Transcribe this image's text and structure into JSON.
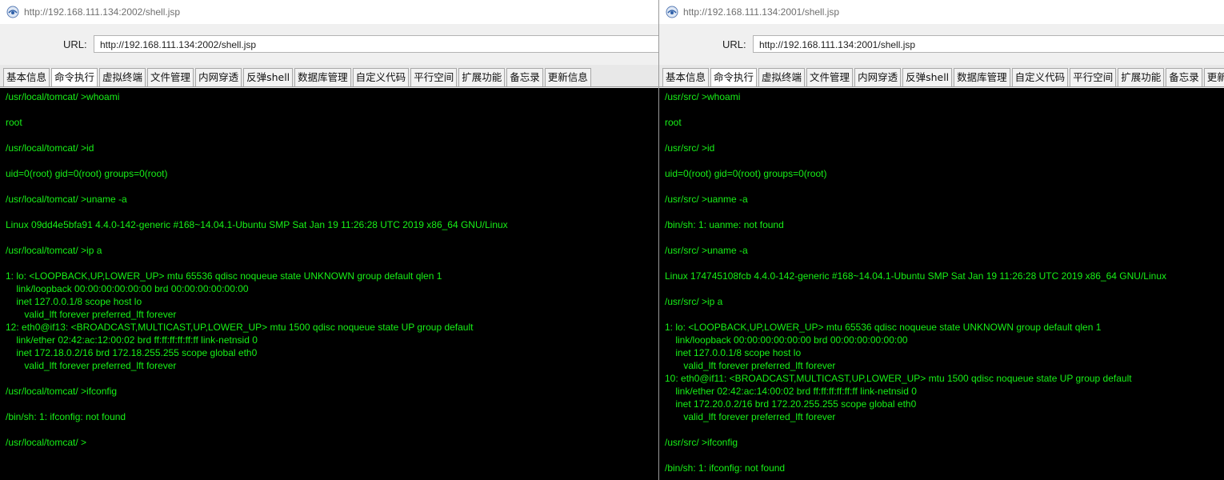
{
  "colors": {
    "terminal_bg": "#000000",
    "terminal_text": "#17f017",
    "chrome_bg": "#f0f0f0"
  },
  "windows": [
    {
      "title": "http://192.168.111.134:2002/shell.jsp",
      "url_label": "URL:",
      "url": "http://192.168.111.134:2002/shell.jsp",
      "active_tab": 1,
      "tabs": [
        "基本信息",
        "命令执行",
        "虚拟终端",
        "文件管理",
        "内网穿透",
        "反弹shell",
        "数据库管理",
        "自定义代码",
        "平行空间",
        "扩展功能",
        "备忘录",
        "更新信息"
      ],
      "lines": [
        "/usr/local/tomcat/ >whoami",
        "",
        "root",
        "",
        "/usr/local/tomcat/ >id",
        "",
        "uid=0(root) gid=0(root) groups=0(root)",
        "",
        "/usr/local/tomcat/ >uname -a",
        "",
        "Linux 09dd4e5bfa91 4.4.0-142-generic #168~14.04.1-Ubuntu SMP Sat Jan 19 11:26:28 UTC 2019 x86_64 GNU/Linux",
        "",
        "/usr/local/tomcat/ >ip a",
        "",
        "1: lo: <LOOPBACK,UP,LOWER_UP> mtu 65536 qdisc noqueue state UNKNOWN group default qlen 1",
        "    link/loopback 00:00:00:00:00:00 brd 00:00:00:00:00:00",
        "    inet 127.0.0.1/8 scope host lo",
        "       valid_lft forever preferred_lft forever",
        "12: eth0@if13: <BROADCAST,MULTICAST,UP,LOWER_UP> mtu 1500 qdisc noqueue state UP group default",
        "    link/ether 02:42:ac:12:00:02 brd ff:ff:ff:ff:ff:ff link-netnsid 0",
        "    inet 172.18.0.2/16 brd 172.18.255.255 scope global eth0",
        "       valid_lft forever preferred_lft forever",
        "",
        "/usr/local/tomcat/ >ifconfig",
        "",
        "/bin/sh: 1: ifconfig: not found",
        "",
        "/usr/local/tomcat/ >"
      ]
    },
    {
      "title": "http://192.168.111.134:2001/shell.jsp",
      "url_label": "URL:",
      "url": "http://192.168.111.134:2001/shell.jsp",
      "active_tab": 1,
      "tabs": [
        "基本信息",
        "命令执行",
        "虚拟终端",
        "文件管理",
        "内网穿透",
        "反弹shell",
        "数据库管理",
        "自定义代码",
        "平行空间",
        "扩展功能",
        "备忘录",
        "更新"
      ],
      "lines": [
        "/usr/src/ >whoami",
        "",
        "root",
        "",
        "/usr/src/ >id",
        "",
        "uid=0(root) gid=0(root) groups=0(root)",
        "",
        "/usr/src/ >uanme -a",
        "",
        "/bin/sh: 1: uanme: not found",
        "",
        "/usr/src/ >uname -a",
        "",
        "Linux 174745108fcb 4.4.0-142-generic #168~14.04.1-Ubuntu SMP Sat Jan 19 11:26:28 UTC 2019 x86_64 GNU/Linux",
        "",
        "/usr/src/ >ip a",
        "",
        "1: lo: <LOOPBACK,UP,LOWER_UP> mtu 65536 qdisc noqueue state UNKNOWN group default qlen 1",
        "    link/loopback 00:00:00:00:00:00 brd 00:00:00:00:00:00",
        "    inet 127.0.0.1/8 scope host lo",
        "       valid_lft forever preferred_lft forever",
        "10: eth0@if11: <BROADCAST,MULTICAST,UP,LOWER_UP> mtu 1500 qdisc noqueue state UP group default",
        "    link/ether 02:42:ac:14:00:02 brd ff:ff:ff:ff:ff:ff link-netnsid 0",
        "    inet 172.20.0.2/16 brd 172.20.255.255 scope global eth0",
        "       valid_lft forever preferred_lft forever",
        "",
        "/usr/src/ >ifconfig",
        "",
        "/bin/sh: 1: ifconfig: not found"
      ]
    }
  ]
}
